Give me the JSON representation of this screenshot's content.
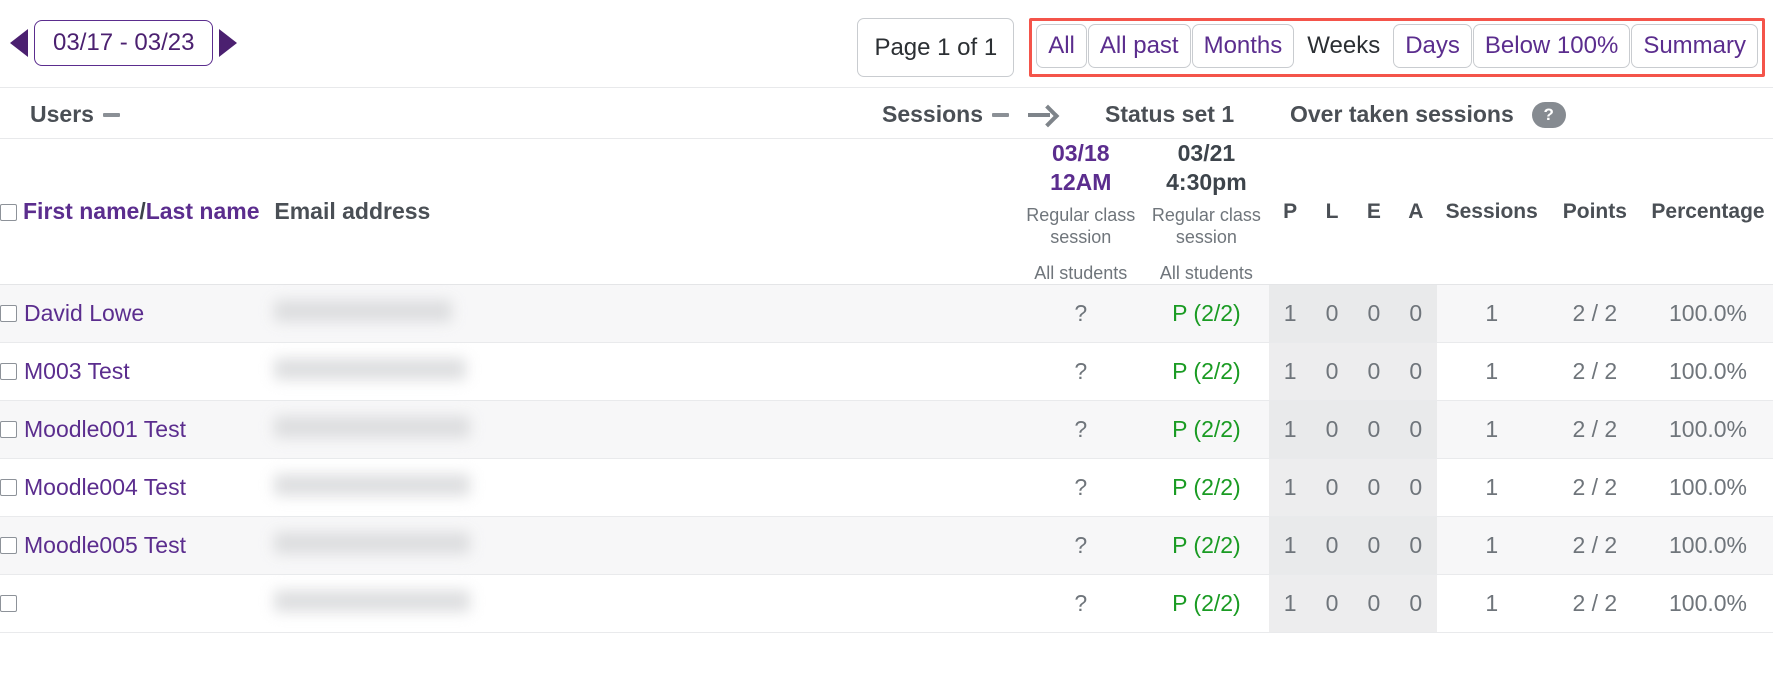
{
  "toolbar": {
    "prev_label": "previous period",
    "next_label": "next period",
    "period": "03/17 - 03/23",
    "page_indicator": "Page 1 of 1",
    "views": [
      {
        "label": "All",
        "current": false
      },
      {
        "label": "All past",
        "current": false
      },
      {
        "label": "Months",
        "current": false
      },
      {
        "label": "Weeks",
        "current": true
      },
      {
        "label": "Days",
        "current": false
      },
      {
        "label": "Below 100%",
        "current": false
      },
      {
        "label": "Summary",
        "current": false
      }
    ],
    "highlight_color": "#f4544a"
  },
  "group_headers": {
    "users": "Users",
    "sessions": "Sessions",
    "status_set": "Status set 1",
    "over_taken": "Over taken sessions",
    "help_glyph": "?"
  },
  "columns": {
    "name": "First name",
    "name_sep": "/",
    "name_last": "Last name",
    "email": "Email address",
    "p": "P",
    "l": "L",
    "e": "E",
    "a": "A",
    "sessions": "Sessions",
    "points": "Points",
    "percentage": "Percentage"
  },
  "sessions": [
    {
      "date": "03/18",
      "time": "12AM",
      "desc_line1": "Regular class",
      "desc_line2": "session",
      "group": "All students",
      "is_link": true
    },
    {
      "date": "03/21",
      "time": "4:30pm",
      "desc_line1": "Regular class",
      "desc_line2": "session",
      "group": "All students",
      "is_link": false
    }
  ],
  "rows": [
    {
      "name": "David Lowe",
      "email": "",
      "marks": [
        "?",
        "P (2/2)"
      ],
      "p": "1",
      "l": "0",
      "e": "0",
      "a": "0",
      "sessions": "1",
      "points": "2 / 2",
      "percentage": "100.0%"
    },
    {
      "name": "M003 Test",
      "email": "",
      "marks": [
        "?",
        "P (2/2)"
      ],
      "p": "1",
      "l": "0",
      "e": "0",
      "a": "0",
      "sessions": "1",
      "points": "2 / 2",
      "percentage": "100.0%"
    },
    {
      "name": "Moodle001 Test",
      "email": "",
      "marks": [
        "?",
        "P (2/2)"
      ],
      "p": "1",
      "l": "0",
      "e": "0",
      "a": "0",
      "sessions": "1",
      "points": "2 / 2",
      "percentage": "100.0%"
    },
    {
      "name": "Moodle004 Test",
      "email": "",
      "marks": [
        "?",
        "P (2/2)"
      ],
      "p": "1",
      "l": "0",
      "e": "0",
      "a": "0",
      "sessions": "1",
      "points": "2 / 2",
      "percentage": "100.0%"
    },
    {
      "name": "Moodle005 Test",
      "email": "",
      "marks": [
        "?",
        "P (2/2)"
      ],
      "p": "1",
      "l": "0",
      "e": "0",
      "a": "0",
      "sessions": "1",
      "points": "2 / 2",
      "percentage": "100.0%"
    },
    {
      "name": "",
      "email": "",
      "marks": [
        "?",
        "P (2/2)"
      ],
      "p": "1",
      "l": "0",
      "e": "0",
      "a": "0",
      "sessions": "1",
      "points": "2 / 2",
      "percentage": "100.0%"
    }
  ],
  "colors": {
    "link_purple": "#5b2d8e",
    "status_present_green": "#1a9b23",
    "muted_gray": "#6f757b",
    "highlight_red": "#f4544a"
  }
}
